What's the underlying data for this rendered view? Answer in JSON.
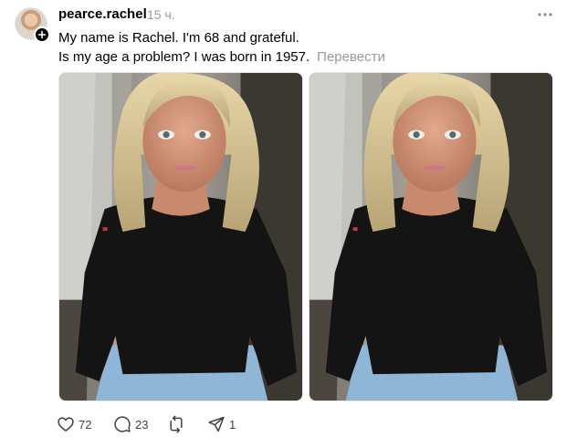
{
  "post": {
    "username": "pearce.rachel",
    "timestamp": "15 ч.",
    "text_line_1": "My name is Rachel. I'm 68 and grateful.",
    "text_line_2": "Is my age a problem? I was born in 1957.",
    "translate_label": "Перевести",
    "media": [
      {
        "description_name": "selfie-photo-1"
      },
      {
        "description_name": "selfie-photo-2"
      }
    ],
    "actions": {
      "likes": "72",
      "comments": "23",
      "reposts": "",
      "shares": "1"
    }
  },
  "icons": {
    "like": "heart-icon",
    "comment": "comment-icon",
    "repost": "repost-icon",
    "share": "share-icon",
    "more": "more-icon",
    "follow": "plus-icon"
  },
  "colors": {
    "muted_text": "#999999",
    "count_text": "#424242",
    "follow_badge": "#000000"
  }
}
